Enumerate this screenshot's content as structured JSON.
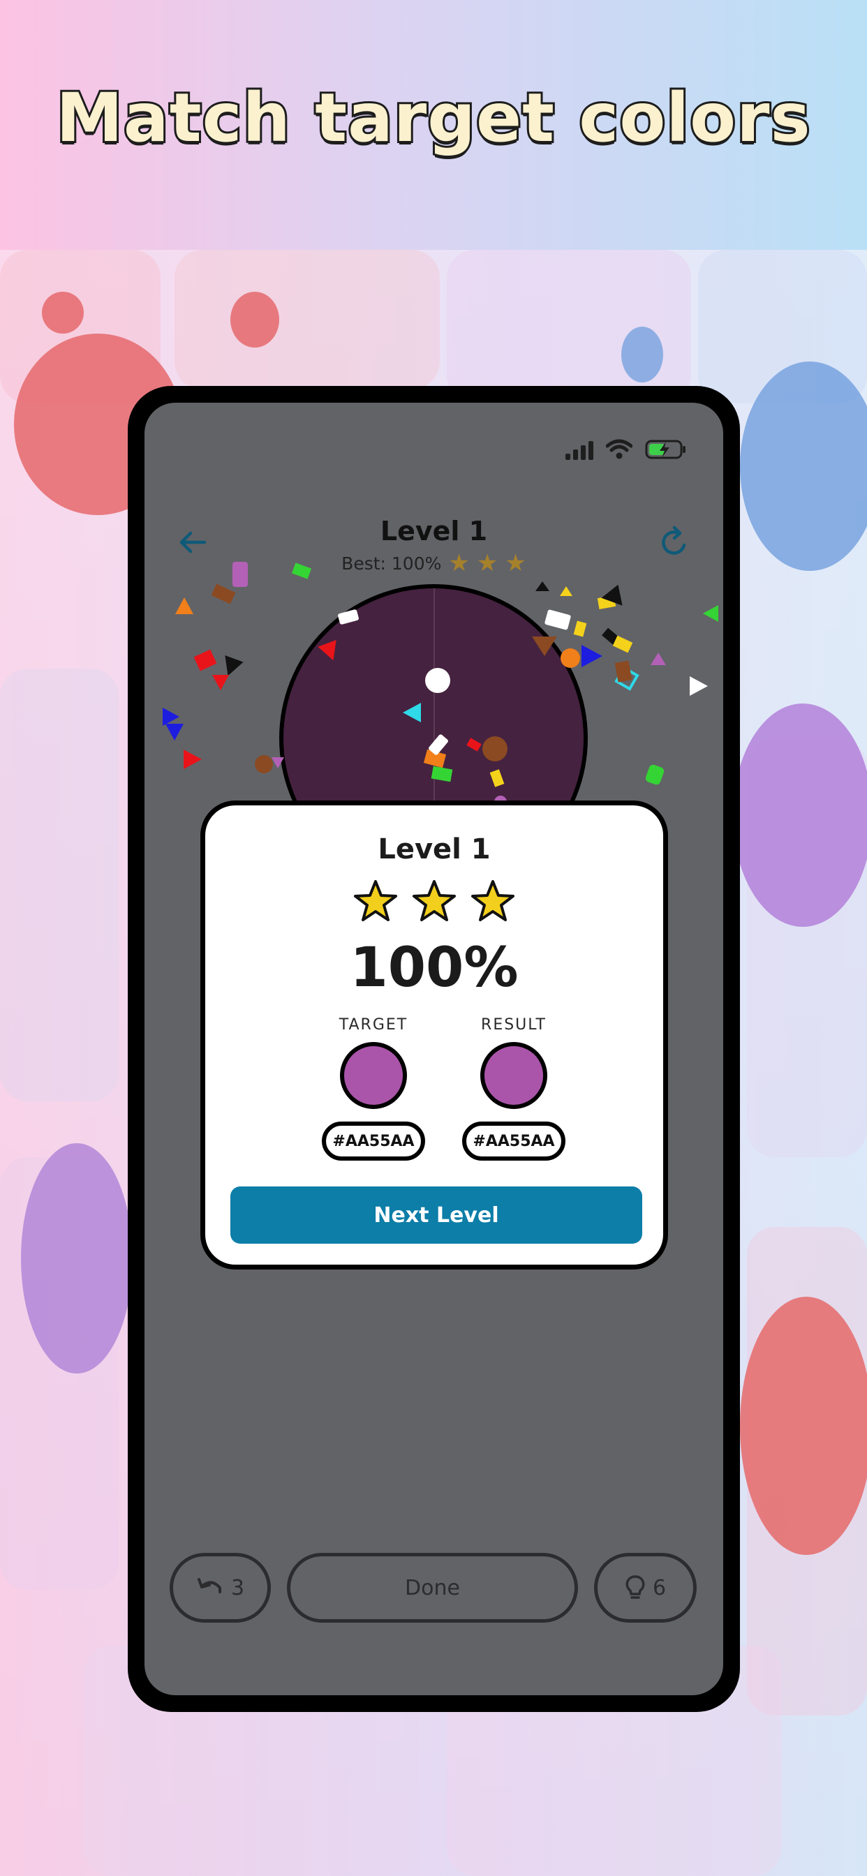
{
  "header": {
    "headline": "Match target colors"
  },
  "status_bar": {
    "signal_icon": "cellular-signal-icon",
    "wifi_icon": "wifi-icon",
    "battery_icon": "battery-charging-icon"
  },
  "top_bar": {
    "back_icon": "arrow-left-icon",
    "title": "Level 1",
    "best_label": "Best: 100%",
    "best_stars": 3,
    "refresh_icon": "refresh-icon"
  },
  "result_card": {
    "title": "Level 1",
    "stars": 3,
    "score": "100%",
    "target_label": "TARGET",
    "result_label": "RESULT",
    "target_color": "#AA55AA",
    "result_color": "#AA55AA",
    "target_hex": "#AA55AA",
    "result_hex": "#AA55AA",
    "next_button": "Next Level"
  },
  "bottom_bar": {
    "undo_count": "3",
    "done_label": "Done",
    "hint_count": "6",
    "undo_icon": "undo-icon",
    "hint_icon": "lightbulb-icon"
  },
  "colors": {
    "accent": "#0c7ea8",
    "bowl": "#45223f",
    "screen": "#626367",
    "star": "#f2cf1d"
  }
}
